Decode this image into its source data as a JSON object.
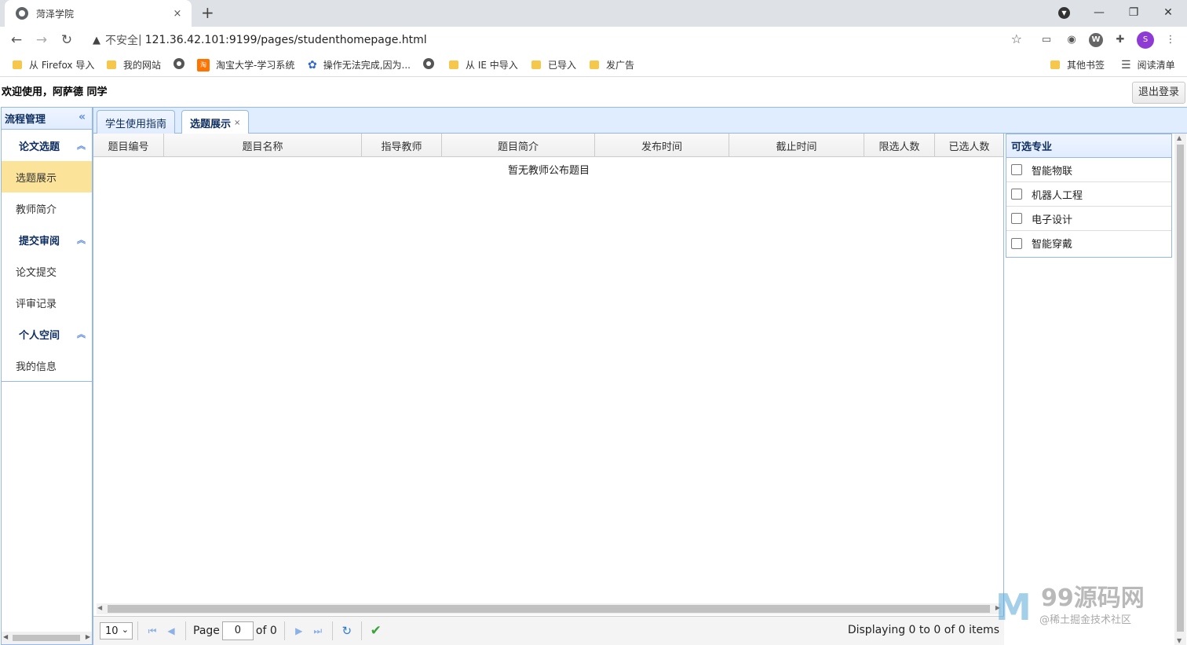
{
  "browser": {
    "tab_title": "菏泽学院",
    "tab_close": "×",
    "new_tab": "+",
    "insecure_label": "不安全",
    "url": "121.36.42.101:9199/pages/studenthomepage.html",
    "profile_initial": "S",
    "ext_w": "W",
    "bookmarks": [
      {
        "label": "从 Firefox 导入",
        "icon": "folder-icon"
      },
      {
        "label": "我的网站",
        "icon": "folder-icon"
      },
      {
        "label": "",
        "icon": "globe-icon"
      },
      {
        "label": "淘宝大学-学习系统",
        "icon": "taobao-icon"
      },
      {
        "label": "操作无法完成,因为...",
        "icon": "paw-icon"
      },
      {
        "label": "",
        "icon": "globe-icon"
      },
      {
        "label": "从 IE 中导入",
        "icon": "folder-icon"
      },
      {
        "label": "已导入",
        "icon": "folder-icon"
      },
      {
        "label": "发广告",
        "icon": "folder-icon"
      }
    ],
    "other_bookmarks": "其他书签",
    "reading_list": "阅读清单"
  },
  "header": {
    "welcome": "欢迎使用，阿萨德 同学",
    "logout": "退出登录"
  },
  "sidebar": {
    "title": "流程管理",
    "sections": [
      {
        "title": "论文选题",
        "items": [
          "选题展示",
          "教师简介"
        ]
      },
      {
        "title": "提交审阅",
        "items": [
          "论文提交",
          "评审记录"
        ]
      },
      {
        "title": "个人空间",
        "items": [
          "我的信息"
        ]
      }
    ],
    "active_item": "选题展示"
  },
  "tabs": [
    {
      "label": "学生使用指南",
      "selected": false
    },
    {
      "label": "选题展示",
      "selected": true,
      "close": "×"
    }
  ],
  "grid": {
    "columns": [
      "题目编号",
      "题目名称",
      "指导教师",
      "题目简介",
      "发布时间",
      "截止时间",
      "限选人数",
      "已选人数"
    ],
    "empty_message": "暂无教师公布题目"
  },
  "pager": {
    "page_size": "10",
    "page_label": "Page",
    "page_value": "0",
    "of_label": "of 0",
    "info": "Displaying 0 to 0 of 0 items"
  },
  "majors": {
    "title": "可选专业",
    "items": [
      "智能物联",
      "机器人工程",
      "电子设计",
      "智能穿戴"
    ]
  },
  "watermark": {
    "brand": "99源码网",
    "sub": "@稀土掘金技术社区"
  },
  "colors": {
    "panel_border": "#95b8e7",
    "panel_header": "#e0ecff",
    "active_item": "#fbe39a",
    "header_text": "#0e2d5f"
  }
}
